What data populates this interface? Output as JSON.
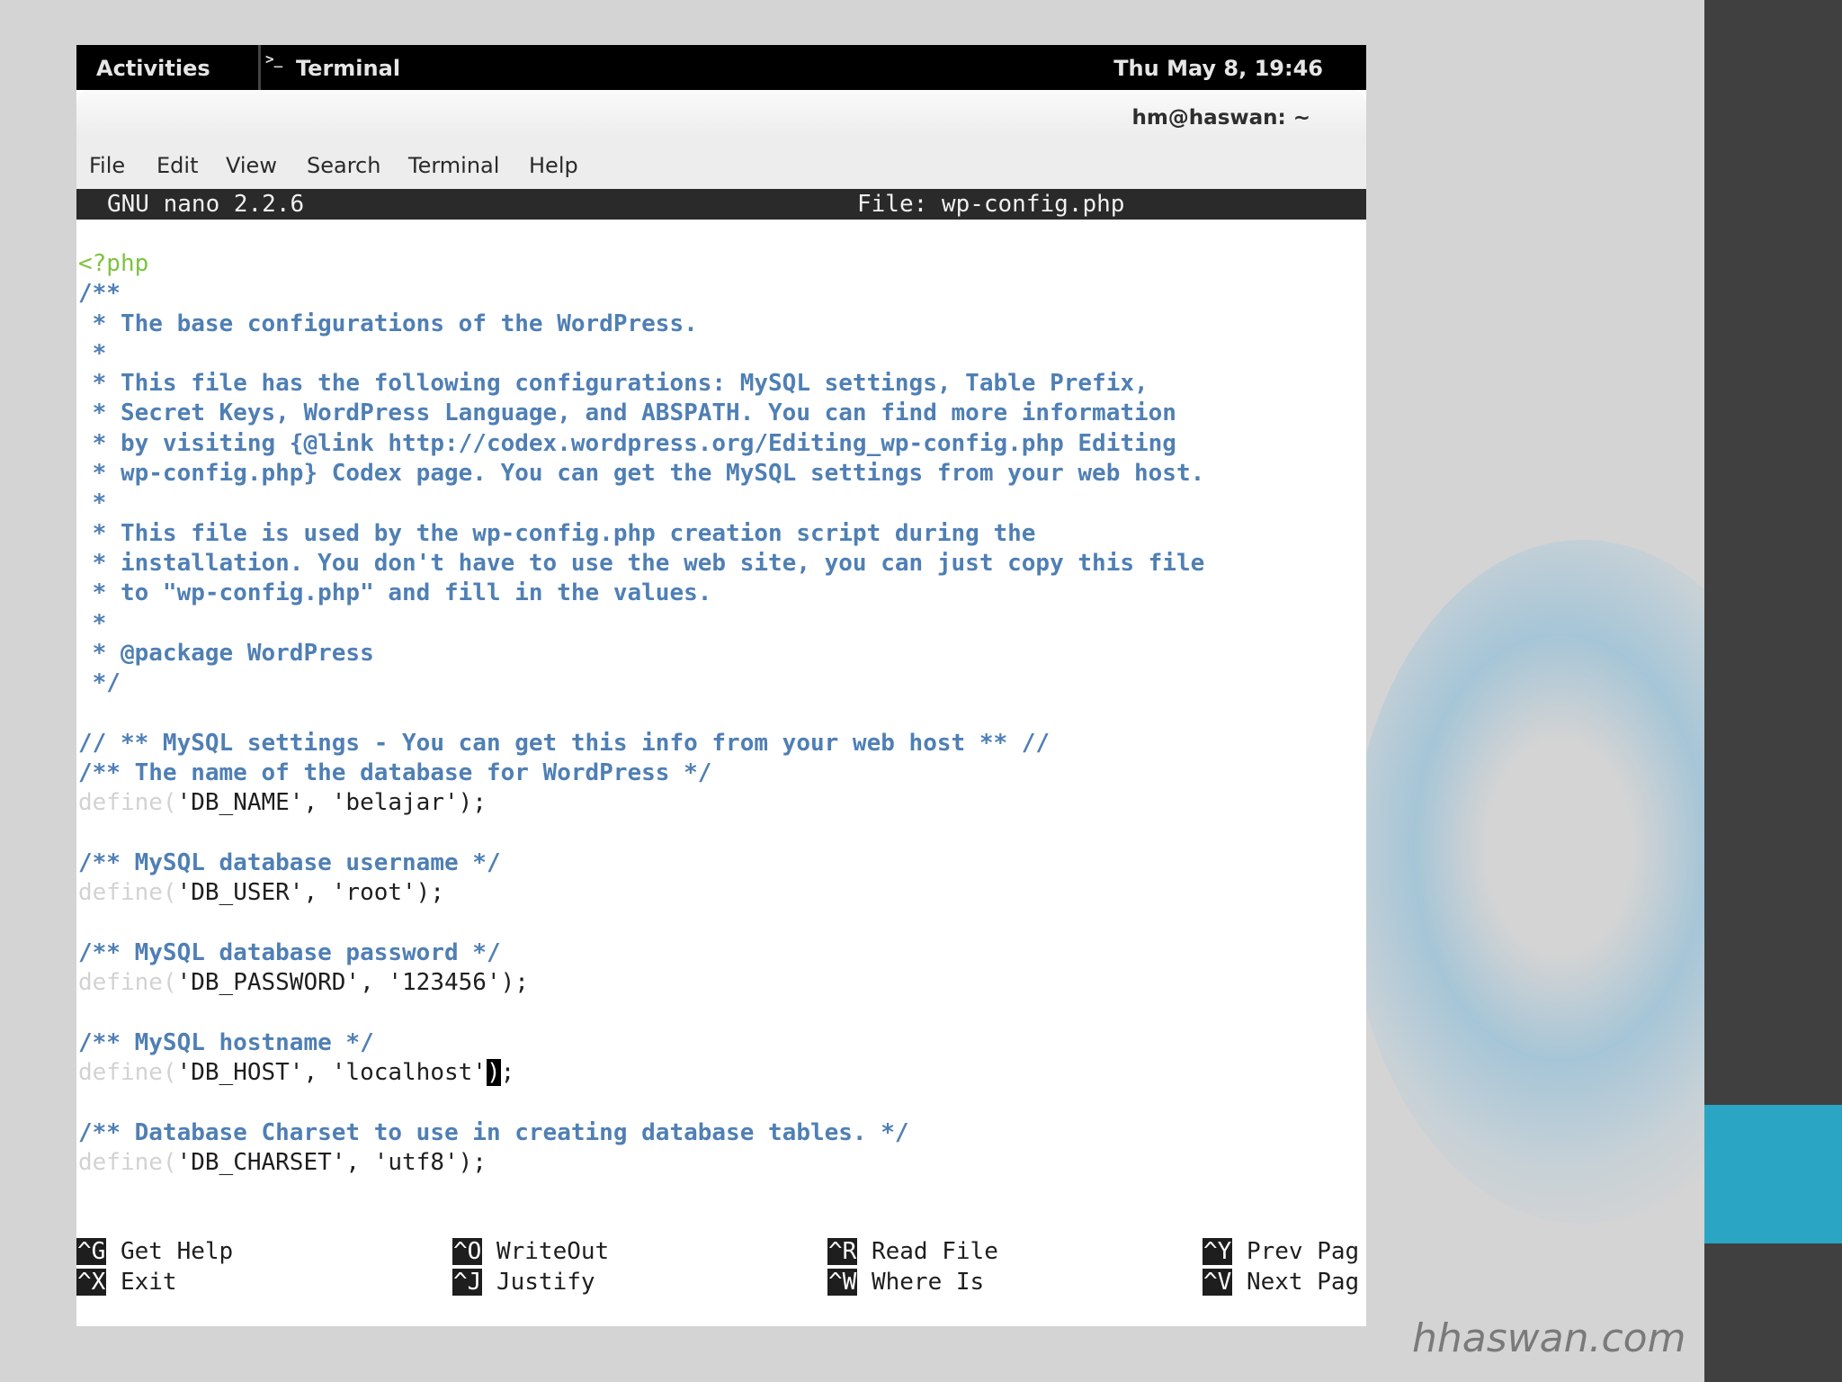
{
  "brand": "hhaswan.com",
  "colors": {
    "accent": "#2aa6c4",
    "sidebar": "#404040"
  },
  "topbar": {
    "activities": "Activities",
    "app_icon": "terminal-icon",
    "app_icon_glyph": ">_",
    "app_name": "Terminal",
    "clock": "Thu May  8, 19:46"
  },
  "window": {
    "title": "hm@haswan: ~"
  },
  "menu": [
    "File",
    "Edit",
    "View",
    "Search",
    "Terminal",
    "Help"
  ],
  "nano": {
    "version": "GNU nano 2.2.6",
    "file": "File: wp-config.php"
  },
  "editor": {
    "lines": [
      {
        "t": "php",
        "s": "<?php"
      },
      {
        "t": "comment",
        "s": "/**"
      },
      {
        "t": "comment",
        "s": " * The base configurations of the WordPress."
      },
      {
        "t": "comment",
        "s": " *"
      },
      {
        "t": "comment",
        "s": " * This file has the following configurations: MySQL settings, Table Prefix,"
      },
      {
        "t": "comment",
        "s": " * Secret Keys, WordPress Language, and ABSPATH. You can find more information"
      },
      {
        "t": "comment",
        "s": " * by visiting {@link http://codex.wordpress.org/Editing_wp-config.php Editing"
      },
      {
        "t": "comment",
        "s": " * wp-config.php} Codex page. You can get the MySQL settings from your web host."
      },
      {
        "t": "comment",
        "s": " *"
      },
      {
        "t": "comment",
        "s": " * This file is used by the wp-config.php creation script during the"
      },
      {
        "t": "comment",
        "s": " * installation. You don't have to use the web site, you can just copy this file"
      },
      {
        "t": "comment",
        "s": " * to \"wp-config.php\" and fill in the values."
      },
      {
        "t": "comment",
        "s": " *"
      },
      {
        "t": "comment",
        "s": " * @package WordPress"
      },
      {
        "t": "comment",
        "s": " */"
      },
      {
        "t": "blank",
        "s": ""
      },
      {
        "t": "comment",
        "s": "// ** MySQL settings - You can get this info from your web host ** //"
      },
      {
        "t": "comment",
        "s": "/** The name of the database for WordPress */"
      },
      {
        "t": "define",
        "def": "define(",
        "s": "'DB_NAME', 'belajar');"
      },
      {
        "t": "blank",
        "s": ""
      },
      {
        "t": "comment",
        "s": "/** MySQL database username */"
      },
      {
        "t": "define",
        "def": "define(",
        "s": "'DB_USER', 'root');"
      },
      {
        "t": "blank",
        "s": ""
      },
      {
        "t": "comment",
        "s": "/** MySQL database password */"
      },
      {
        "t": "define",
        "def": "define(",
        "s": "'DB_PASSWORD', '123456');"
      },
      {
        "t": "blank",
        "s": ""
      },
      {
        "t": "comment",
        "s": "/** MySQL hostname */"
      },
      {
        "t": "define",
        "def": "define(",
        "s": "'DB_HOST', 'localhost'",
        "cursor": ")",
        "after": ";"
      },
      {
        "t": "blank",
        "s": ""
      },
      {
        "t": "comment",
        "s": "/** Database Charset to use in creating database tables. */"
      },
      {
        "t": "define",
        "def": "define(",
        "s": "'DB_CHARSET', 'utf8');"
      }
    ]
  },
  "shortcuts": [
    {
      "key": "^G",
      "label": "Get Help"
    },
    {
      "key": "^O",
      "label": "WriteOut"
    },
    {
      "key": "^R",
      "label": "Read File"
    },
    {
      "key": "^Y",
      "label": "Prev Pag"
    },
    {
      "key": "^X",
      "label": "Exit"
    },
    {
      "key": "^J",
      "label": "Justify"
    },
    {
      "key": "^W",
      "label": "Where Is"
    },
    {
      "key": "^V",
      "label": "Next Pag"
    }
  ]
}
